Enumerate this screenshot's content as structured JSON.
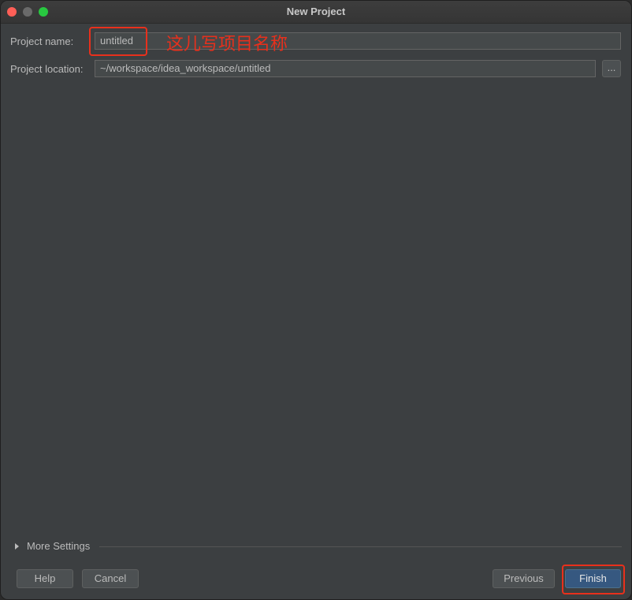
{
  "window": {
    "title": "New Project"
  },
  "form": {
    "project_name_label": "Project name:",
    "project_name_value": "untitled",
    "project_location_label": "Project location:",
    "project_location_value": "~/workspace/idea_workspace/untitled",
    "browse_label": "..."
  },
  "annotation": {
    "text": "这儿写项目名称",
    "color": "#e8301c"
  },
  "more_settings": {
    "label": "More Settings"
  },
  "footer": {
    "help_label": "Help",
    "cancel_label": "Cancel",
    "previous_label": "Previous",
    "finish_label": "Finish"
  },
  "colors": {
    "background": "#3c3f41",
    "primary_button": "#365880",
    "highlight": "#e8301c"
  }
}
